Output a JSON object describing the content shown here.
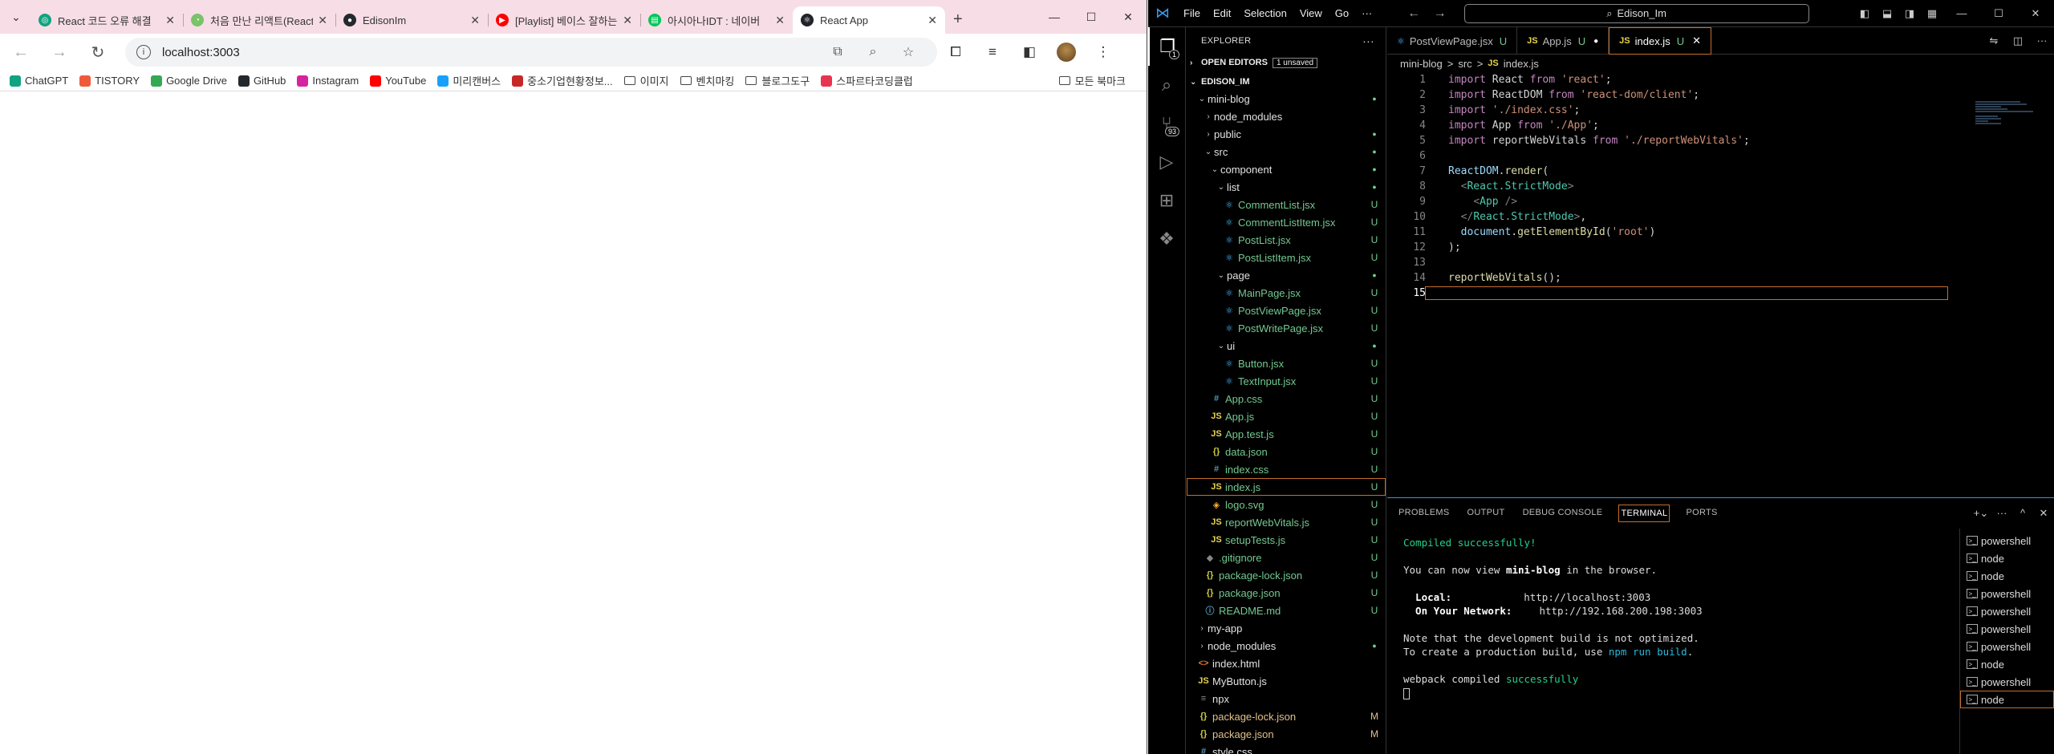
{
  "chrome": {
    "tabs": [
      {
        "title": "React 코드 오류 해결",
        "fav_color": "#10a37f",
        "fav": "◎",
        "active": false
      },
      {
        "title": "처음 만난 리액트(React)",
        "fav_color": "#79c36a",
        "fav": "◔",
        "active": false
      },
      {
        "title": "EdisonIm",
        "fav_color": "#24292e",
        "fav": "●",
        "active": false
      },
      {
        "title": "[Playlist] 베이스 잘하는",
        "fav_color": "#ff0000",
        "fav": "▶",
        "active": false
      },
      {
        "title": "아시아나IDT : 네이버",
        "fav_color": "#03c75a",
        "fav": "▤",
        "active": false
      },
      {
        "title": "React App",
        "fav_color": "#20232a",
        "fav": "⚛",
        "active": true
      }
    ],
    "url": "localhost:3003",
    "bookmarks": [
      {
        "label": "ChatGPT",
        "color": "#10a37f",
        "type": "site"
      },
      {
        "label": "TISTORY",
        "color": "#ef5a3c",
        "type": "site"
      },
      {
        "label": "Google Drive",
        "color": "#34a853",
        "type": "site"
      },
      {
        "label": "GitHub",
        "color": "#24292e",
        "type": "site"
      },
      {
        "label": "Instagram",
        "color": "#d6249f",
        "type": "site"
      },
      {
        "label": "YouTube",
        "color": "#ff0000",
        "type": "site"
      },
      {
        "label": "미리캔버스",
        "color": "#18a0fb",
        "type": "site"
      },
      {
        "label": "중소기업현황정보...",
        "color": "#c62828",
        "type": "site"
      },
      {
        "label": "이미지",
        "color": "",
        "type": "folder"
      },
      {
        "label": "벤치마킹",
        "color": "",
        "type": "folder"
      },
      {
        "label": "블로그도구",
        "color": "",
        "type": "folder"
      },
      {
        "label": "스파르타코딩클럽",
        "color": "#e8344e",
        "type": "site"
      }
    ],
    "all_bookmarks": "모든 북마크"
  },
  "vscode": {
    "menu": [
      "File",
      "Edit",
      "Selection",
      "View",
      "Go",
      "···"
    ],
    "search": "Edison_Im",
    "explorer_title": "EXPLORER",
    "open_editors": "OPEN EDITORS",
    "unsaved": "1 unsaved",
    "root": "EDISON_IM",
    "tree": [
      {
        "name": "mini-blog",
        "depth": 1,
        "kind": "folder",
        "open": true,
        "status": "dot"
      },
      {
        "name": "node_modules",
        "depth": 2,
        "kind": "folder",
        "open": false,
        "status": ""
      },
      {
        "name": "public",
        "depth": 2,
        "kind": "folder",
        "open": false,
        "status": "dot"
      },
      {
        "name": "src",
        "depth": 2,
        "kind": "folder",
        "open": true,
        "status": "dot"
      },
      {
        "name": "component",
        "depth": 3,
        "kind": "folder",
        "open": true,
        "status": "dot"
      },
      {
        "name": "list",
        "depth": 4,
        "kind": "folder",
        "open": true,
        "status": "dot"
      },
      {
        "name": "CommentList.jsx",
        "depth": 5,
        "kind": "jsx",
        "status": "U"
      },
      {
        "name": "CommentListItem.jsx",
        "depth": 5,
        "kind": "jsx",
        "status": "U"
      },
      {
        "name": "PostList.jsx",
        "depth": 5,
        "kind": "jsx",
        "status": "U"
      },
      {
        "name": "PostListItem.jsx",
        "depth": 5,
        "kind": "jsx",
        "status": "U"
      },
      {
        "name": "page",
        "depth": 4,
        "kind": "folder",
        "open": true,
        "status": "dot"
      },
      {
        "name": "MainPage.jsx",
        "depth": 5,
        "kind": "jsx",
        "status": "U"
      },
      {
        "name": "PostViewPage.jsx",
        "depth": 5,
        "kind": "jsx",
        "status": "U"
      },
      {
        "name": "PostWritePage.jsx",
        "depth": 5,
        "kind": "jsx",
        "status": "U"
      },
      {
        "name": "ui",
        "depth": 4,
        "kind": "folder",
        "open": true,
        "status": "dot"
      },
      {
        "name": "Button.jsx",
        "depth": 5,
        "kind": "jsx",
        "status": "U"
      },
      {
        "name": "TextInput.jsx",
        "depth": 5,
        "kind": "jsx",
        "status": "U"
      },
      {
        "name": "App.css",
        "depth": 3,
        "kind": "css",
        "status": "U"
      },
      {
        "name": "App.js",
        "depth": 3,
        "kind": "js",
        "status": "U"
      },
      {
        "name": "App.test.js",
        "depth": 3,
        "kind": "js",
        "status": "U"
      },
      {
        "name": "data.json",
        "depth": 3,
        "kind": "json",
        "status": "U"
      },
      {
        "name": "index.css",
        "depth": 3,
        "kind": "css",
        "status": "U"
      },
      {
        "name": "index.js",
        "depth": 3,
        "kind": "js",
        "status": "U",
        "selected": true
      },
      {
        "name": "logo.svg",
        "depth": 3,
        "kind": "svg",
        "status": "U"
      },
      {
        "name": "reportWebVitals.js",
        "depth": 3,
        "kind": "js",
        "status": "U"
      },
      {
        "name": "setupTests.js",
        "depth": 3,
        "kind": "js",
        "status": "U"
      },
      {
        "name": ".gitignore",
        "depth": 2,
        "kind": "git",
        "status": "U"
      },
      {
        "name": "package-lock.json",
        "depth": 2,
        "kind": "json",
        "status": "U"
      },
      {
        "name": "package.json",
        "depth": 2,
        "kind": "json",
        "status": "U"
      },
      {
        "name": "README.md",
        "depth": 2,
        "kind": "md",
        "status": "U"
      },
      {
        "name": "my-app",
        "depth": 1,
        "kind": "folder",
        "open": false,
        "status": ""
      },
      {
        "name": "node_modules",
        "depth": 1,
        "kind": "folder",
        "open": false,
        "status": "dot"
      },
      {
        "name": "index.html",
        "depth": 1,
        "kind": "html",
        "status": ""
      },
      {
        "name": "MyButton.js",
        "depth": 1,
        "kind": "js",
        "status": ""
      },
      {
        "name": "npx",
        "depth": 1,
        "kind": "txt",
        "status": ""
      },
      {
        "name": "package-lock.json",
        "depth": 1,
        "kind": "json",
        "status": "M"
      },
      {
        "name": "package.json",
        "depth": 1,
        "kind": "json",
        "status": "M"
      },
      {
        "name": "style.css",
        "depth": 1,
        "kind": "css",
        "status": ""
      }
    ],
    "editor_tabs": [
      {
        "name": "PostViewPage.jsx",
        "kind": "jsx",
        "status": "U",
        "active": false,
        "dirty": false
      },
      {
        "name": "App.js",
        "kind": "js",
        "status": "U",
        "active": false,
        "dirty": true
      },
      {
        "name": "index.js",
        "kind": "js",
        "status": "U",
        "active": true,
        "dirty": false
      }
    ],
    "breadcrumbs": [
      "mini-blog",
      ">",
      "src",
      ">",
      "JS",
      "index.js"
    ],
    "code_lines": [
      "import React from 'react';",
      "import ReactDOM from 'react-dom/client';",
      "import './index.css';",
      "import App from './App';",
      "import reportWebVitals from './reportWebVitals';",
      "",
      "ReactDOM.render(",
      "  <React.StrictMode>",
      "    <App />",
      "  </React.StrictMode>,",
      "  document.getElementById('root')",
      ");",
      "",
      "reportWebVitals();",
      ""
    ],
    "current_line": 15,
    "panel_tabs": [
      "PROBLEMS",
      "OUTPUT",
      "DEBUG CONSOLE",
      "TERMINAL",
      "PORTS"
    ],
    "active_panel": "TERMINAL",
    "terminal": {
      "compiled": "Compiled successfully!",
      "view_pre": "You can now view ",
      "view_app": "mini-blog",
      "view_post": " in the browser.",
      "local_label": "  Local:",
      "local_url": "http://localhost:3003",
      "network_label": "  On Your Network:",
      "network_url": "http://192.168.200.198:3003",
      "note1": "Note that the development build is not optimized.",
      "note2_pre": "To create a production build, use ",
      "note2_cmd": "npm run build",
      "note2_post": ".",
      "webpack_pre": "webpack compiled ",
      "webpack_ok": "successfully"
    },
    "terminals": [
      "powershell",
      "node",
      "node",
      "powershell",
      "powershell",
      "powershell",
      "powershell",
      "node",
      "powershell",
      "node"
    ],
    "selected_terminal": 9
  }
}
